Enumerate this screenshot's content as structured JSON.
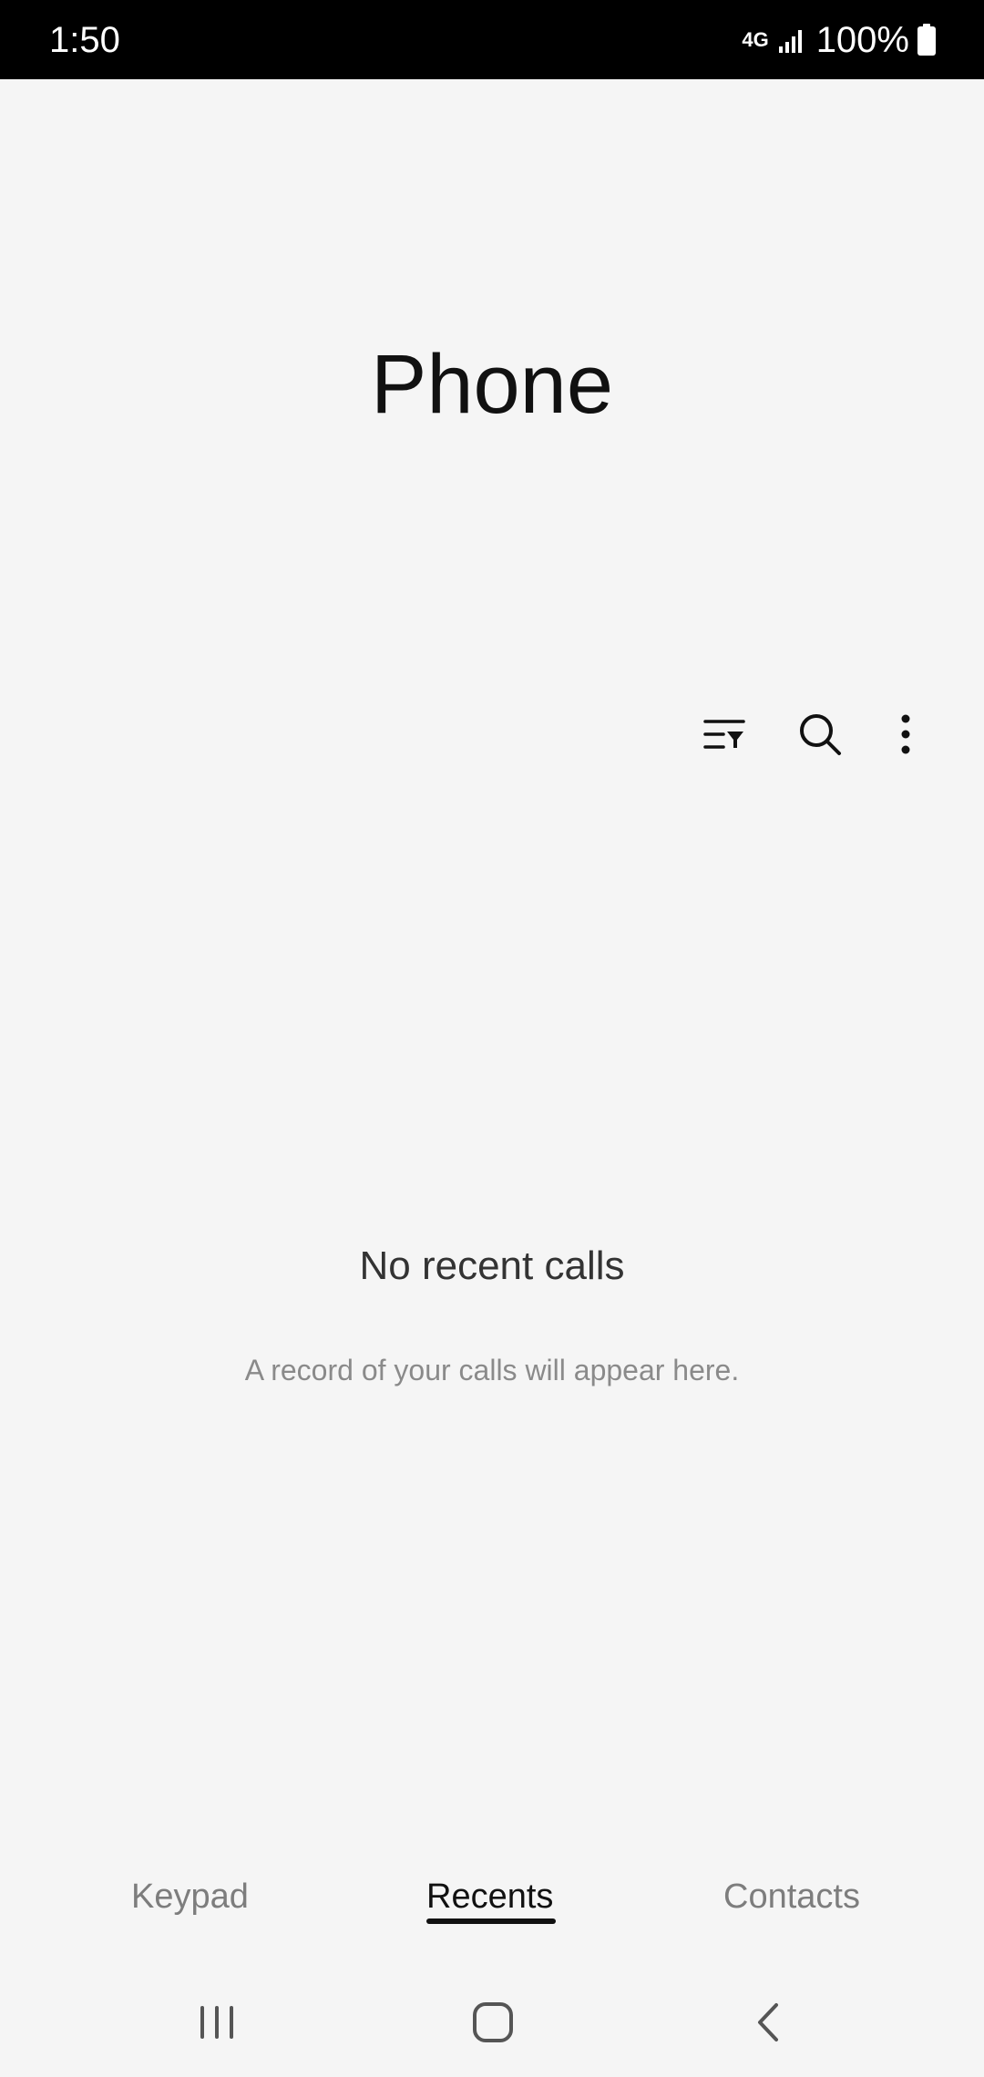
{
  "status_bar": {
    "time": "1:50",
    "network": "4G",
    "battery": "100%",
    "icons": [
      "4g-lte-icon",
      "signal-icon",
      "battery-icon"
    ]
  },
  "app": {
    "title": "Phone"
  },
  "toolbar": {
    "icons": [
      "filter-icon",
      "search-icon",
      "more-options-icon"
    ]
  },
  "empty_state": {
    "title": "No recent calls",
    "subtitle": "A record of your calls will appear here."
  },
  "tabs": [
    {
      "label": "Keypad",
      "selected": false
    },
    {
      "label": "Recents",
      "selected": true
    },
    {
      "label": "Contacts",
      "selected": false
    }
  ],
  "nav_bar": {
    "icons": [
      "recent-apps-icon",
      "home-icon",
      "back-icon"
    ]
  },
  "colors": {
    "background": "#f5f5f5",
    "status_bar": "#000000",
    "text_primary": "#111111",
    "text_secondary": "#8a8a8a",
    "tab_inactive": "#7d7d7d"
  }
}
